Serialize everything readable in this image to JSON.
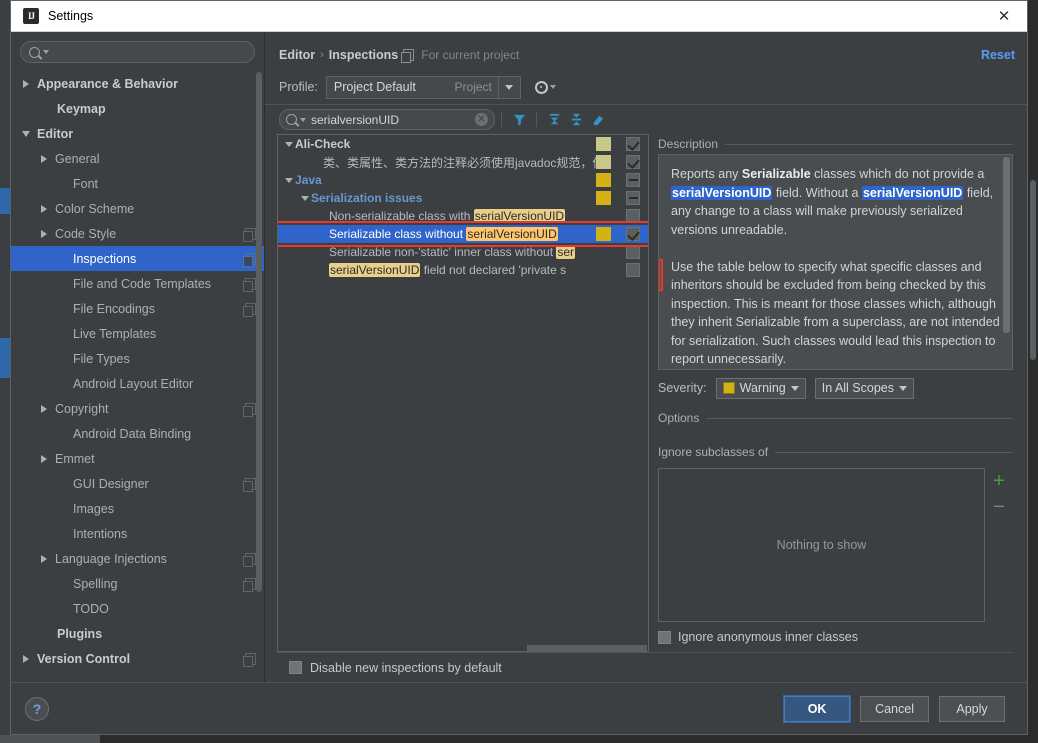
{
  "window": {
    "title": "Settings",
    "icon": "intellij-idea-icon",
    "close_label": "✕"
  },
  "sidebar": {
    "search": {
      "value": "",
      "placeholder": ""
    },
    "items": [
      {
        "label": "Appearance & Behavior",
        "arrow": "right",
        "bold": true,
        "indent": 10,
        "copy": false
      },
      {
        "label": "Keymap",
        "arrow": "none",
        "bold": true,
        "indent": 30,
        "copy": false
      },
      {
        "label": "Editor",
        "arrow": "down",
        "bold": true,
        "indent": 10,
        "copy": false
      },
      {
        "label": "General",
        "arrow": "right",
        "bold": false,
        "indent": 28,
        "copy": false
      },
      {
        "label": "Font",
        "arrow": "none",
        "bold": false,
        "indent": 46,
        "copy": false
      },
      {
        "label": "Color Scheme",
        "arrow": "right",
        "bold": false,
        "indent": 28,
        "copy": false
      },
      {
        "label": "Code Style",
        "arrow": "right",
        "bold": false,
        "indent": 28,
        "copy": true
      },
      {
        "label": "Inspections",
        "arrow": "none",
        "bold": false,
        "indent": 46,
        "copy": true,
        "selected": true
      },
      {
        "label": "File and Code Templates",
        "arrow": "none",
        "bold": false,
        "indent": 46,
        "copy": true
      },
      {
        "label": "File Encodings",
        "arrow": "none",
        "bold": false,
        "indent": 46,
        "copy": true
      },
      {
        "label": "Live Templates",
        "arrow": "none",
        "bold": false,
        "indent": 46,
        "copy": false
      },
      {
        "label": "File Types",
        "arrow": "none",
        "bold": false,
        "indent": 46,
        "copy": false
      },
      {
        "label": "Android Layout Editor",
        "arrow": "none",
        "bold": false,
        "indent": 46,
        "copy": false
      },
      {
        "label": "Copyright",
        "arrow": "right",
        "bold": false,
        "indent": 28,
        "copy": true
      },
      {
        "label": "Android Data Binding",
        "arrow": "none",
        "bold": false,
        "indent": 46,
        "copy": false
      },
      {
        "label": "Emmet",
        "arrow": "right",
        "bold": false,
        "indent": 28,
        "copy": false
      },
      {
        "label": "GUI Designer",
        "arrow": "none",
        "bold": false,
        "indent": 46,
        "copy": true
      },
      {
        "label": "Images",
        "arrow": "none",
        "bold": false,
        "indent": 46,
        "copy": false
      },
      {
        "label": "Intentions",
        "arrow": "none",
        "bold": false,
        "indent": 46,
        "copy": false
      },
      {
        "label": "Language Injections",
        "arrow": "right",
        "bold": false,
        "indent": 28,
        "copy": true
      },
      {
        "label": "Spelling",
        "arrow": "none",
        "bold": false,
        "indent": 46,
        "copy": true
      },
      {
        "label": "TODO",
        "arrow": "none",
        "bold": false,
        "indent": 46,
        "copy": false
      },
      {
        "label": "Plugins",
        "arrow": "none",
        "bold": true,
        "indent": 30,
        "copy": false
      },
      {
        "label": "Version Control",
        "arrow": "right",
        "bold": true,
        "indent": 10,
        "copy": true
      }
    ]
  },
  "header": {
    "breadcrumb_parent": "Editor",
    "breadcrumb_sep": "›",
    "breadcrumb_current": "Inspections",
    "scope_note": "For current project",
    "reset_label": "Reset"
  },
  "profile": {
    "label": "Profile:",
    "value": "Project Default",
    "sub": "Project",
    "gear_icon": "gear-icon"
  },
  "filterbar": {
    "search_value": "serialversionUID",
    "search_placeholder": "",
    "clear_icon": "clear-icon",
    "icons": [
      "filter-icon",
      "expand-all-icon",
      "collapse-all-icon",
      "reset-filter-icon"
    ]
  },
  "inspections": [
    {
      "label": "Ali-Check",
      "style": "grp",
      "arrow": "down",
      "indent": 6,
      "severity": "#c8c888",
      "checkbox": "checked"
    },
    {
      "label": "类、类属性、类方法的注释必须使用javadoc规范，使",
      "style": "plain",
      "arrow": "none",
      "indent": 34,
      "severity": "#c8c888",
      "checkbox": "checked"
    },
    {
      "label": "Java",
      "style": "blue",
      "arrow": "down",
      "indent": 6,
      "severity": "#d4b215",
      "checkbox": "partial"
    },
    {
      "label": "Serialization issues",
      "style": "blue",
      "arrow": "down",
      "indent": 22,
      "severity": "#d4b215",
      "checkbox": "partial"
    },
    {
      "label_parts": [
        {
          "t": "Non-serializable class with ",
          "h": false
        },
        {
          "t": "serialVersionUID",
          "h": true
        }
      ],
      "style": "plain",
      "arrow": "none",
      "indent": 40,
      "severity": "",
      "checkbox": "empty"
    },
    {
      "label_parts": [
        {
          "t": "Serializable class without ",
          "h": false
        },
        {
          "t": "serialVersionUID",
          "h": true
        }
      ],
      "style": "plain",
      "arrow": "none",
      "indent": 40,
      "severity": "#d4b215",
      "checkbox": "checked",
      "selected": true,
      "highlighted": true
    },
    {
      "label_parts": [
        {
          "t": "Serializable non-'static' inner class without ",
          "h": false
        },
        {
          "t": "ser",
          "h": true
        }
      ],
      "style": "plain",
      "arrow": "none",
      "indent": 40,
      "severity": "",
      "checkbox": "empty"
    },
    {
      "label_parts": [
        {
          "t": "serialVersionUID",
          "h": true
        },
        {
          "t": " field not declared 'private s",
          "h": false
        }
      ],
      "style": "plain",
      "arrow": "none",
      "indent": 40,
      "severity": "",
      "checkbox": "empty"
    }
  ],
  "description": {
    "heading": "Description",
    "html": "Reports any <b>Serializable</b> classes which do not provide a <span class=\"selhl\">serialVersionUID</span> field. Without a <span class=\"selhl\">serialVersionUID</span> field, any change to a class will make previously serialized versions unreadable.<br><br>Use the table below to specify what specific classes and inheritors should be excluded from being checked by this inspection. This is meant for those classes which, although they inherit Serializable from a superclass, are not intended for serialization. Such classes would lead this inspection to report unnecessarily.<br><br>Use the checkbox below to ignore <b>Serializable</b>"
  },
  "severity": {
    "label": "Severity:",
    "value": "Warning",
    "swatch_color": "#d4b215",
    "scope_value": "In All Scopes"
  },
  "options": {
    "heading": "Options",
    "ignore_subclasses_heading": "Ignore subclasses of",
    "empty_table_text": "Nothing to show",
    "add_label": "+",
    "remove_label": "−",
    "ignore_anon_label": "Ignore anonymous inner classes",
    "ignore_anon_checked": false
  },
  "bottom": {
    "disable_new_label": "Disable new inspections by default",
    "disable_new_checked": false,
    "help_label": "?",
    "ok_label": "OK",
    "cancel_label": "Cancel",
    "apply_label": "Apply"
  },
  "colors": {
    "accent_blue": "#2f65ca",
    "link_blue": "#589df6",
    "warning_yellow": "#d4b215",
    "highlight_orange": "#ffc66d",
    "red_annotation": "#e8392a"
  }
}
